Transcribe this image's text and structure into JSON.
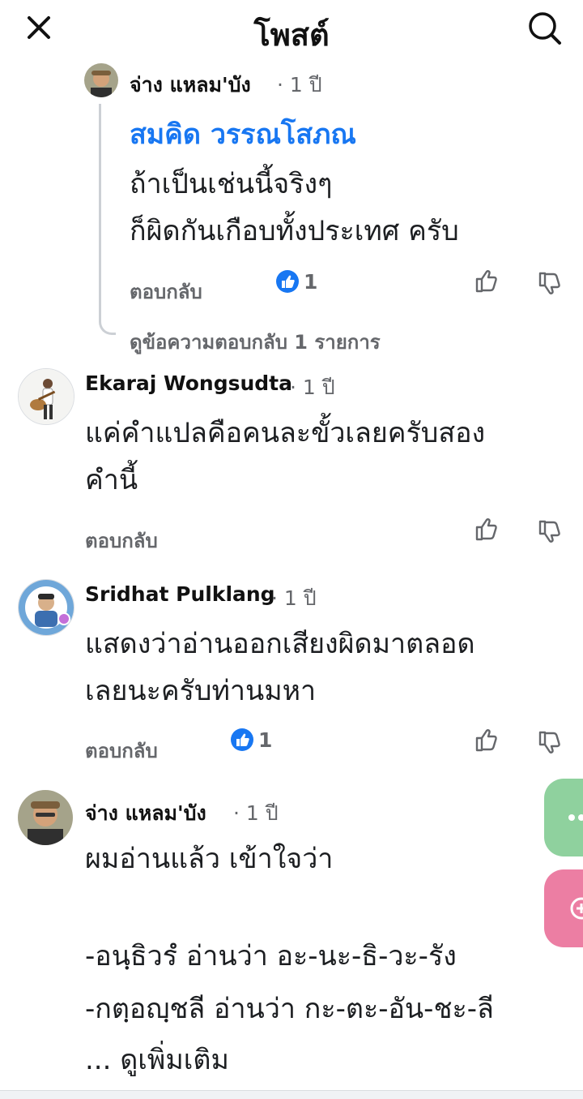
{
  "header": {
    "title": "โพสต์"
  },
  "thread": {
    "reply": {
      "author": "จ่าง แหลม'บัง",
      "time": "· 1 ปี",
      "mention": "สมคิด วรรณโสภณ",
      "text": "ถ้าเป็นเช่นนี้จริงๆ\nก็ผิดกันเกือบทั้งประเทศ ครับ",
      "reply_label": "ตอบกลับ",
      "reaction_count": "1"
    },
    "view_replies": "ดูข้อความตอบกลับ 1 รายการ"
  },
  "comments": [
    {
      "author": "Ekaraj Wongsudta",
      "time": "· 1 ปี",
      "text": "แค่คำแปลคือคนละขั้วเลยครับสอง\nคำนี้",
      "reply_label": "ตอบกลับ"
    },
    {
      "author": "Sridhat Pulklang",
      "time": "· 1 ปี",
      "text": "แสดงว่าอ่านออกเสียงผิดมาตลอด\nเลยนะครับท่านมหา",
      "reply_label": "ตอบกลับ",
      "reaction_count": "1"
    },
    {
      "author": "จ่าง แหลม'บัง",
      "time": "· 1 ปี",
      "text": "ผมอ่านแล้ว เข้าใจว่า",
      "line2": "-อนฺธิวรํ อ่านว่า อะ-นะ-ธิ-วะ-รัง",
      "line3": "-กตฺอญฺชลี อ่านว่า กะ-ตะ-อัน-ชะ-ลี",
      "see_more": "... ดูเพิ่มเติม"
    }
  ],
  "colors": {
    "accent": "#1877f2",
    "muted": "#65676b",
    "fab_green": "#8fd19e",
    "fab_pink": "#ec7ea3"
  },
  "icons": [
    "close-icon",
    "search-icon",
    "like-icon",
    "thumbs-up-icon",
    "thumbs-down-icon"
  ]
}
